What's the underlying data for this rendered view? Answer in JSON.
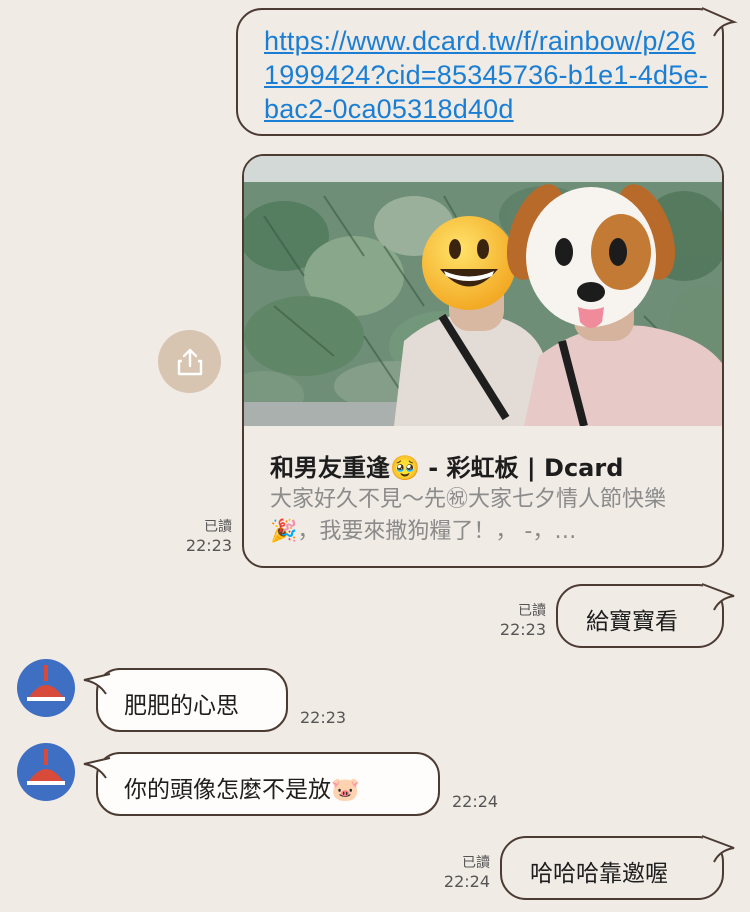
{
  "messages": {
    "link": {
      "url": "https://www.dcard.tw/f/rainbow/p/261999424?cid=85345736-b1e1-4d5e-bac2-0ca05318d40d"
    },
    "preview": {
      "title": "和男友重逢🥹 - 彩虹板 | Dcard",
      "description": "大家好久不見～先㊗大家七夕情人節快樂🎉，我要來撒狗糧了！， -，…",
      "read_label": "已讀",
      "time": "22:23"
    },
    "out1": {
      "text": "給寶寶看",
      "read_label": "已讀",
      "time": "22:23"
    },
    "in1": {
      "text": "肥肥的心思",
      "time": "22:23"
    },
    "in2": {
      "text": "你的頭像怎麼不是放🐷",
      "time": "22:24"
    },
    "out2": {
      "text": "哈哈哈靠邀喔",
      "read_label": "已讀",
      "time": "22:24"
    }
  },
  "icons": {
    "share": "share-icon",
    "avatar": "lamp-icon",
    "face_sticker_1": "smiley-face-sticker",
    "face_sticker_2": "dog-face-sticker"
  },
  "colors": {
    "background": "#f1ebe5",
    "bubble_border": "#4b3b33",
    "link": "#1a7fd4",
    "share_button": "#d7c4b1",
    "avatar_bg": "#3e6fc3"
  }
}
